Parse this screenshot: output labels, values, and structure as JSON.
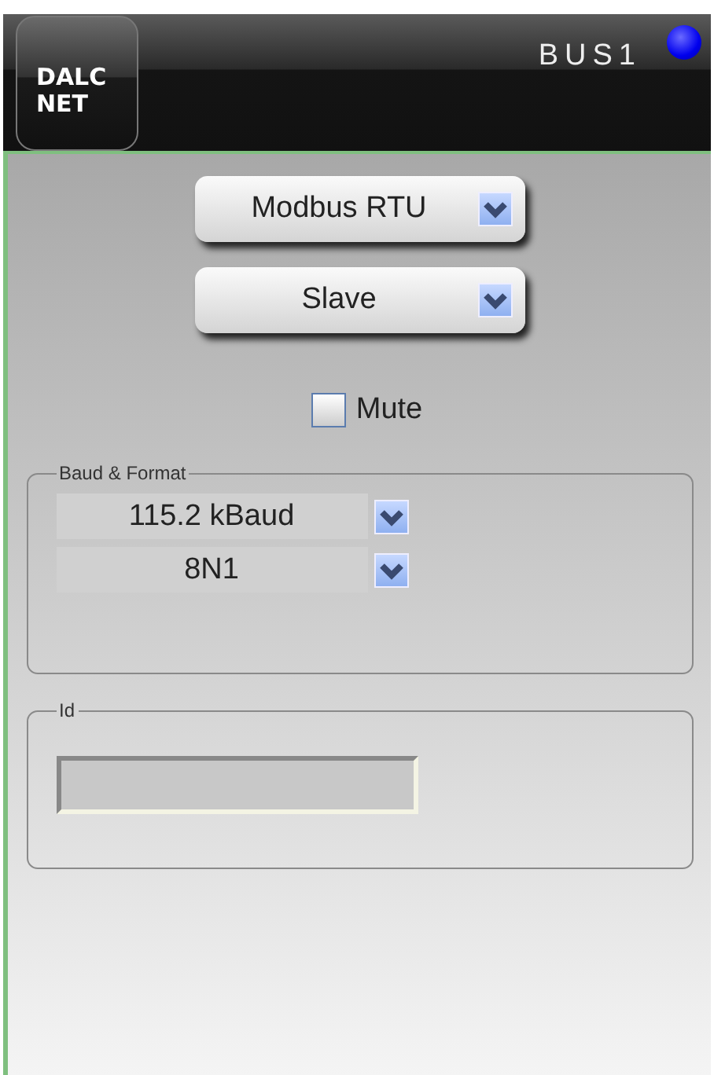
{
  "header": {
    "logo": [
      "DALC",
      "NET"
    ],
    "title": "BUS1"
  },
  "dropdowns": [
    {
      "value": "Modbus RTU"
    },
    {
      "value": "Slave"
    }
  ],
  "mute": {
    "label": "Mute",
    "checked": false
  },
  "baud_format": {
    "legend": "Baud & Format",
    "selects": [
      {
        "value": "115.2 kBaud"
      },
      {
        "value": "8N1"
      }
    ]
  },
  "id": {
    "legend": "Id"
  }
}
